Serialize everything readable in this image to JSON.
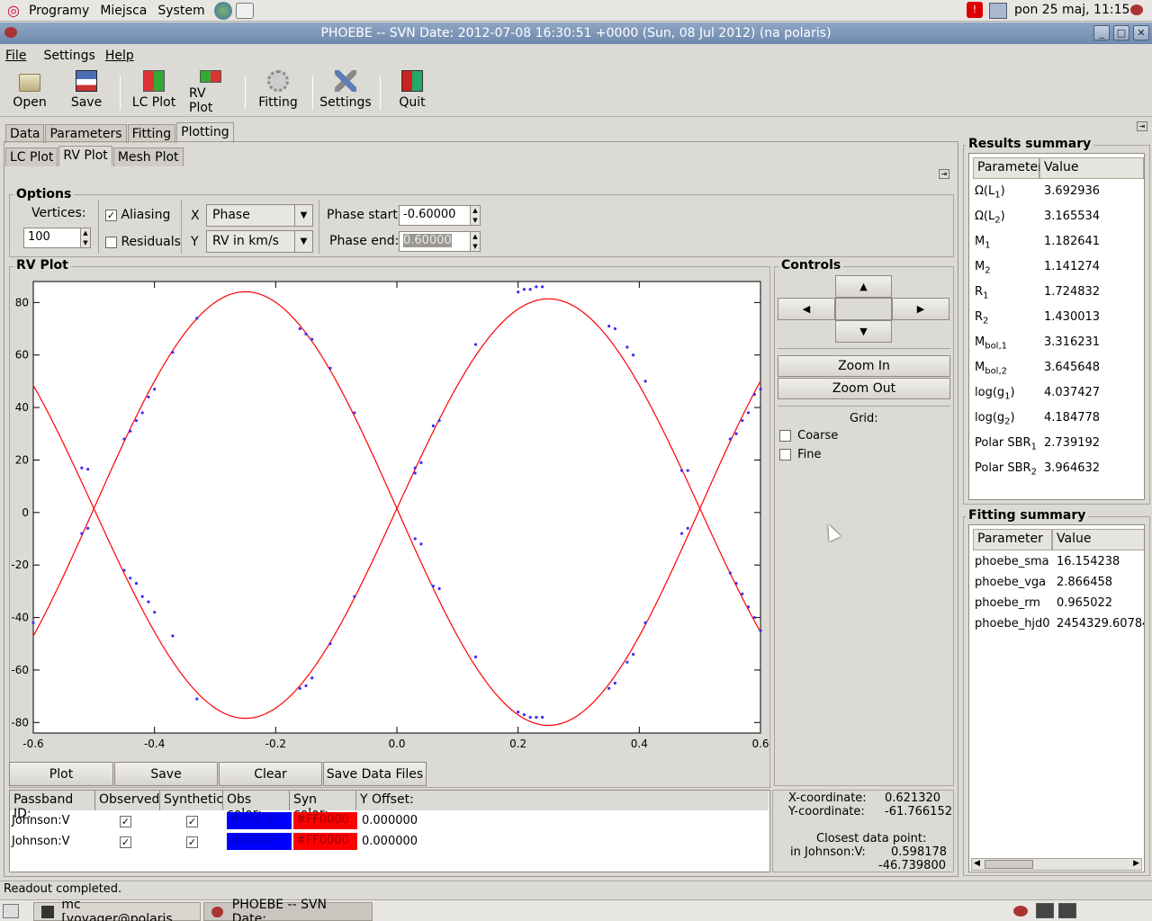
{
  "topbar": {
    "menus": [
      "Programy",
      "Miejsca",
      "System"
    ],
    "clock": "pon 25 maj, 11:15"
  },
  "window": {
    "title": "PHOEBE -- SVN Date: 2012-07-08 16:30:51 +0000 (Sun, 08 Jul 2012)  (na polaris)"
  },
  "menubar": {
    "file": "File",
    "settings": "Settings",
    "help": "Help"
  },
  "toolbar": {
    "open": "Open",
    "save": "Save",
    "lcplot": "LC Plot",
    "rvplot": "RV Plot",
    "fitting": "Fitting",
    "settings": "Settings",
    "quit": "Quit"
  },
  "tabs": {
    "main": [
      "Data",
      "Parameters",
      "Fitting",
      "Plotting"
    ],
    "sub": [
      "LC Plot",
      "RV Plot",
      "Mesh Plot"
    ]
  },
  "options": {
    "title": "Options",
    "vertices_label": "Vertices:",
    "vertices": "100",
    "aliasing": "Aliasing",
    "residuals": "Residuals",
    "x_label": "X",
    "x_value": "Phase",
    "y_label": "Y",
    "y_value": "RV in km/s",
    "phase_start_label": "Phase start:",
    "phase_start": "-0.60000",
    "phase_end_label": "Phase end:",
    "phase_end": "0.60000"
  },
  "rvplot": {
    "title": "RV Plot"
  },
  "chart_data": {
    "type": "line",
    "xlim": [
      -0.6,
      0.6
    ],
    "ylim": [
      -84,
      88
    ],
    "xticks": [
      "-0.6",
      "-0.4",
      "-0.2",
      "0.0",
      "0.2",
      "0.4",
      "0.6"
    ],
    "yticks": [
      "80",
      "60",
      "40",
      "20",
      "0",
      "-20",
      "-40",
      "-60",
      "-80"
    ],
    "grid": false,
    "series": [
      {
        "color": "#FF0000",
        "amplitude_a": 82.6,
        "amplitude_b": 79.9,
        "offset": 1.5
      },
      {
        "color": "#0000FF",
        "note_points": "observations"
      }
    ],
    "obs_a": [
      [
        -0.52,
        17
      ],
      [
        -0.51,
        16.5
      ],
      [
        -0.45,
        28
      ],
      [
        -0.44,
        31
      ],
      [
        -0.43,
        35
      ],
      [
        -0.42,
        38
      ],
      [
        -0.41,
        44
      ],
      [
        -0.4,
        47
      ],
      [
        -0.37,
        61
      ],
      [
        -0.33,
        74
      ],
      [
        -0.16,
        70
      ],
      [
        -0.15,
        68
      ],
      [
        -0.14,
        66
      ],
      [
        -0.11,
        55
      ],
      [
        -0.07,
        38
      ],
      [
        0.03,
        15
      ],
      [
        0.03,
        17
      ],
      [
        0.04,
        19
      ],
      [
        0.06,
        33
      ],
      [
        0.07,
        35
      ],
      [
        0.13,
        64
      ],
      [
        0.2,
        84
      ],
      [
        0.21,
        85
      ],
      [
        0.22,
        85
      ],
      [
        0.23,
        86
      ],
      [
        0.24,
        86
      ],
      [
        0.35,
        71
      ],
      [
        0.36,
        70
      ],
      [
        0.38,
        63
      ],
      [
        0.39,
        60
      ],
      [
        0.41,
        50
      ],
      [
        0.47,
        16
      ],
      [
        0.48,
        16
      ],
      [
        0.55,
        28
      ],
      [
        0.56,
        30
      ],
      [
        0.57,
        35
      ],
      [
        0.58,
        38
      ],
      [
        0.59,
        45
      ],
      [
        0.6,
        47
      ]
    ],
    "obs_b": [
      [
        -0.6,
        -42
      ],
      [
        -0.52,
        -8
      ],
      [
        -0.51,
        -6
      ],
      [
        -0.45,
        -22
      ],
      [
        -0.44,
        -25
      ],
      [
        -0.43,
        -27
      ],
      [
        -0.42,
        -32
      ],
      [
        -0.41,
        -34
      ],
      [
        -0.4,
        -38
      ],
      [
        -0.37,
        -47
      ],
      [
        -0.33,
        -71
      ],
      [
        -0.16,
        -67
      ],
      [
        -0.15,
        -66
      ],
      [
        -0.14,
        -63
      ],
      [
        -0.11,
        -50
      ],
      [
        -0.07,
        -32
      ],
      [
        0.03,
        -10
      ],
      [
        0.04,
        -12
      ],
      [
        0.06,
        -28
      ],
      [
        0.07,
        -29
      ],
      [
        0.13,
        -55
      ],
      [
        0.2,
        -76
      ],
      [
        0.21,
        -77
      ],
      [
        0.22,
        -78
      ],
      [
        0.23,
        -78
      ],
      [
        0.24,
        -78
      ],
      [
        0.35,
        -67
      ],
      [
        0.36,
        -65
      ],
      [
        0.38,
        -57
      ],
      [
        0.39,
        -54
      ],
      [
        0.41,
        -42
      ],
      [
        0.47,
        -8
      ],
      [
        0.48,
        -6
      ],
      [
        0.55,
        -23
      ],
      [
        0.56,
        -27
      ],
      [
        0.57,
        -31
      ],
      [
        0.58,
        -36
      ],
      [
        0.59,
        -40
      ],
      [
        0.6,
        -45
      ]
    ]
  },
  "buttons": {
    "plot": "Plot",
    "save": "Save",
    "clear": "Clear",
    "savedata": "Save Data Files"
  },
  "controls": {
    "title": "Controls",
    "zoom_in": "Zoom In",
    "zoom_out": "Zoom Out",
    "grid": "Grid:",
    "coarse": "Coarse",
    "fine": "Fine"
  },
  "coords": {
    "x_label": "X-coordinate:",
    "x": "0.621320",
    "y_label": "Y-coordinate:",
    "y": "-61.766152",
    "closest": "Closest data point:",
    "in_label": "in Johnson:V:",
    "cx": "0.598178",
    "cy": "-46.739800"
  },
  "legend": {
    "headers": [
      "Passband ID:",
      "Observed:",
      "Synthetic:",
      "Obs color:",
      "Syn color:",
      "Y Offset:"
    ],
    "rows": [
      {
        "id": "Johnson:V",
        "obs": "#0000FF",
        "syn": "#FF0000",
        "offset": "0.000000"
      },
      {
        "id": "Johnson:V",
        "obs": "#0000FF",
        "syn": "#FF0000",
        "offset": "0.000000"
      }
    ]
  },
  "results": {
    "title": "Results summary",
    "h_param": "Parameter",
    "h_value": "Value",
    "rows": [
      [
        "Ω(L",
        "1",
        ")",
        "3.692936"
      ],
      [
        "Ω(L",
        "2",
        ")",
        "3.165534"
      ],
      [
        "M",
        "1",
        "",
        "1.182641"
      ],
      [
        "M",
        "2",
        "",
        "1.141274"
      ],
      [
        "R",
        "1",
        "",
        "1.724832"
      ],
      [
        "R",
        "2",
        "",
        "1.430013"
      ],
      [
        "M",
        "bol,1",
        "",
        "3.316231"
      ],
      [
        "M",
        "bol,2",
        "",
        "3.645648"
      ],
      [
        "log(g",
        "1",
        ")",
        "4.037427"
      ],
      [
        "log(g",
        "2",
        ")",
        "4.184778"
      ],
      [
        "Polar SBR",
        "1",
        "",
        "2.739192"
      ],
      [
        "Polar SBR",
        "2",
        "",
        "3.964632"
      ]
    ]
  },
  "fitting": {
    "title": "Fitting summary",
    "h_param": "Parameter",
    "h_value": "Value",
    "rows": [
      [
        "phoebe_sma",
        "16.154238"
      ],
      [
        "phoebe_vga",
        "2.866458"
      ],
      [
        "phoebe_rm",
        "0.965022"
      ],
      [
        "phoebe_hjd0",
        "2454329.60784"
      ]
    ]
  },
  "status": "Readout completed.",
  "taskbar": {
    "t1": "mc [voyager@polaris...",
    "t2": "PHOEBE -- SVN Date:..."
  }
}
